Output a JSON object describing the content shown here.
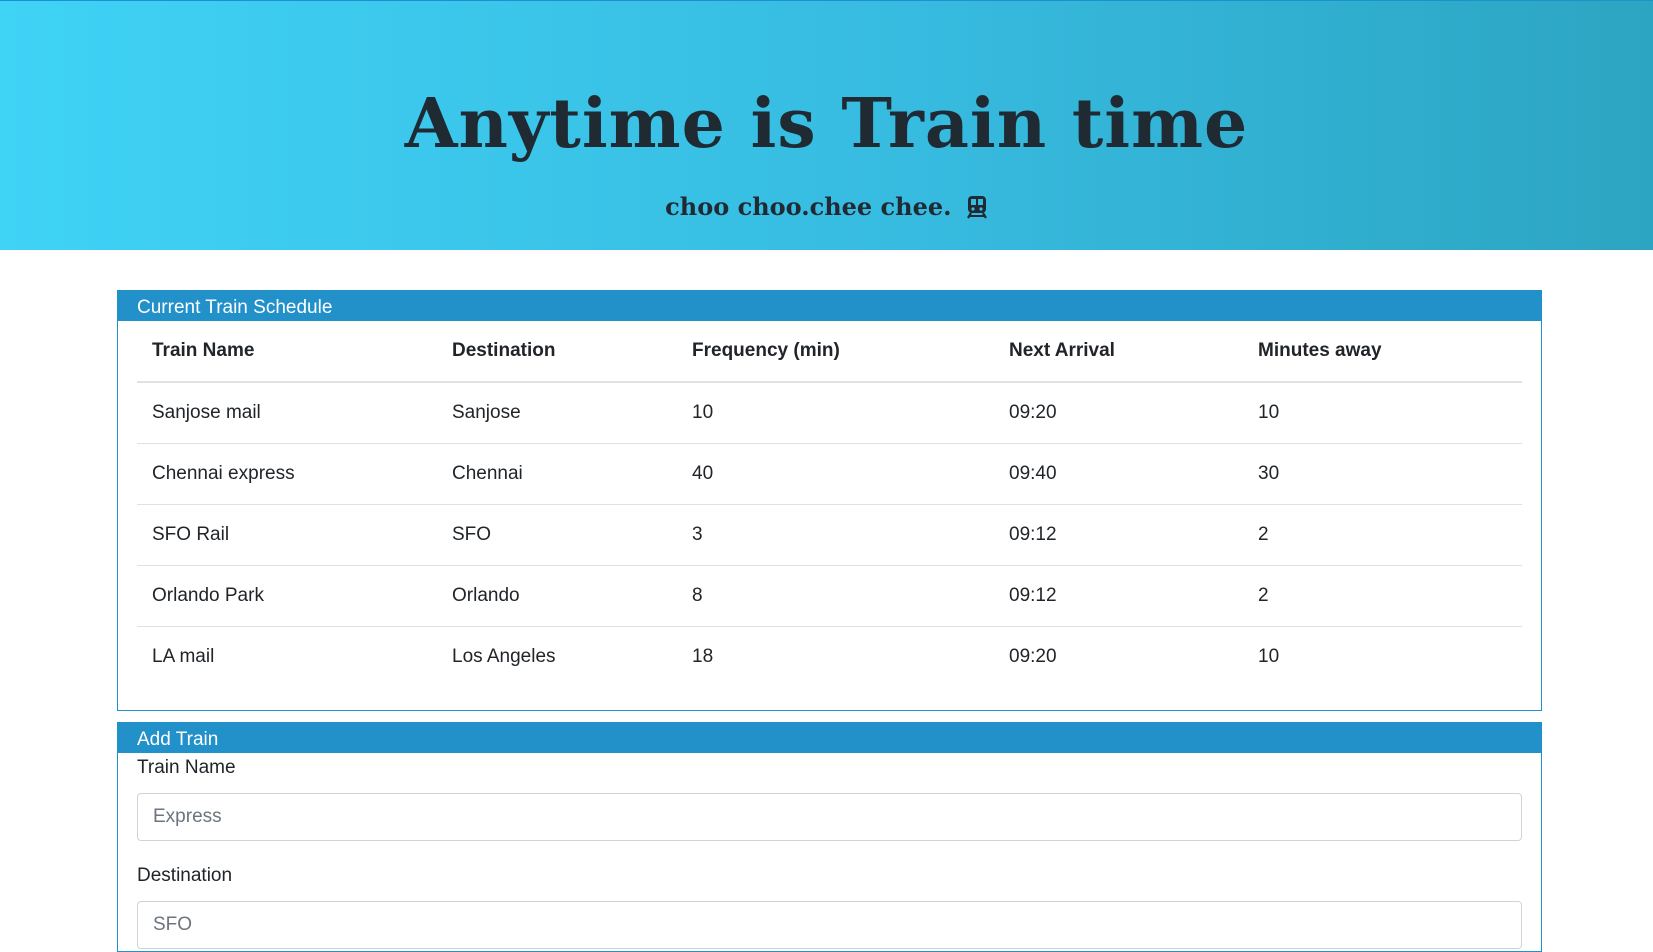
{
  "hero": {
    "title": "Anytime is Train time",
    "subtitle": "choo choo.chee chee.",
    "icon": "train-icon"
  },
  "schedule": {
    "header": "Current Train Schedule",
    "columns": [
      "Train Name",
      "Destination",
      "Frequency (min)",
      "Next Arrival",
      "Minutes away"
    ],
    "rows": [
      [
        "Sanjose mail",
        "Sanjose",
        "10",
        "09:20",
        "10"
      ],
      [
        "Chennai express",
        "Chennai",
        "40",
        "09:40",
        "30"
      ],
      [
        "SFO Rail",
        "SFO",
        "3",
        "09:12",
        "2"
      ],
      [
        "Orlando Park",
        "Orlando",
        "8",
        "09:12",
        "2"
      ],
      [
        "LA mail",
        "Los Angeles",
        "18",
        "09:20",
        "10"
      ]
    ]
  },
  "add_train": {
    "header": "Add Train",
    "train_name_label": "Train Name",
    "train_name_placeholder": "Express",
    "destination_label": "Destination",
    "destination_placeholder": "SFO"
  },
  "colors": {
    "accent": "#2290c9",
    "hero_start": "#3fd3f6",
    "hero_end": "#2ca5c2"
  }
}
